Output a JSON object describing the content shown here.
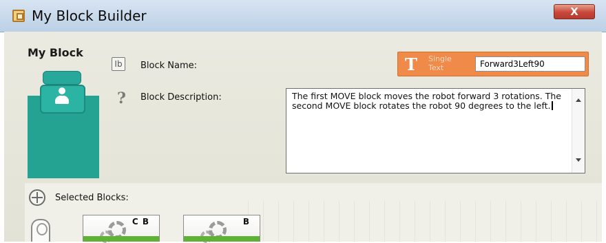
{
  "window": {
    "title": "My Block Builder",
    "close_label": "X"
  },
  "my_block": {
    "heading": "My Block"
  },
  "block_name": {
    "label": "Block Name:",
    "type_label": "Single Text",
    "value": "Forward3Left90"
  },
  "block_description": {
    "label": "Block Description:",
    "text": "The first MOVE block moves the robot forward 3 rotations. The second MOVE block rotates the robot 90 degrees to the left."
  },
  "selected_blocks": {
    "label": "Selected Blocks:",
    "blocks": [
      {
        "ports": "C B"
      },
      {
        "ports": "B"
      }
    ]
  },
  "colors": {
    "accent_orange": "#f08a48",
    "block_teal": "#24a292",
    "move_green": "#5fb236",
    "close_red": "#c8473a"
  },
  "icons": [
    "window-app-icon",
    "close-icon",
    "name-field-icon",
    "help-icon",
    "single-text-icon",
    "crosshair-icon",
    "robot-slot-icon",
    "gear-icon"
  ]
}
